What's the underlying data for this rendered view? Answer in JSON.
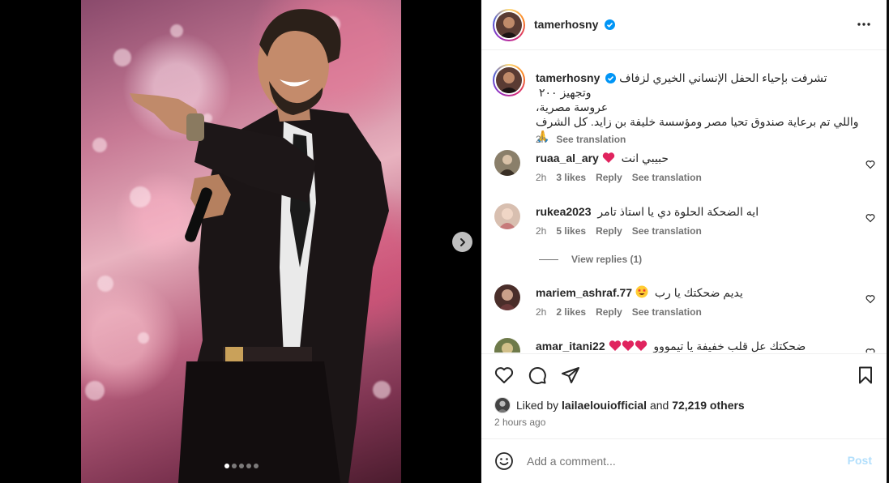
{
  "post": {
    "username": "tamerhosny",
    "caption_lines": [
      "تشرفت بإحياء الحفل الإنساني الخيري لزفاف وتجهيز ٢٠٠",
      "عروسة مصرية،",
      "واللي تم برعاية صندوق تحيا مصر ومؤسسة خليفة بن زايد. كل الشرف 🙏"
    ],
    "caption_time": "2h",
    "see_translation": "See translation"
  },
  "comments": [
    {
      "username": "ruaa_al_ary",
      "text": "حبيبي انت",
      "emoji": "red-heart",
      "time": "2h",
      "likes": "3 likes",
      "reply": "Reply",
      "translate": "See translation"
    },
    {
      "username": "rukea2023",
      "text": "ايه الضحكة الحلوة دي يا استاذ تامر",
      "emoji": "",
      "time": "2h",
      "likes": "5 likes",
      "reply": "Reply",
      "translate": "See translation"
    },
    {
      "username": "mariem_ashraf.77",
      "text": "يديم ضحكتك يا رب",
      "emoji": "star-struck",
      "time": "2h",
      "likes": "2 likes",
      "reply": "Reply",
      "translate": "See translation"
    },
    {
      "username": "amar_itani22",
      "text": "ضحكتك عل قلب خفيفة يا تيمووو",
      "emoji": "three-red-hearts",
      "time": "",
      "likes": "",
      "reply": "",
      "translate": ""
    }
  ],
  "view_replies": "View replies (1)",
  "liked_by": {
    "prefix": "Liked by",
    "user": "lailaelouiofficial",
    "middle": "and",
    "count": "72,219 others"
  },
  "posted_ago": "2 hours ago",
  "add_comment": {
    "placeholder": "Add a comment...",
    "post_label": "Post"
  },
  "carousel": {
    "slides": 5,
    "active": 1
  },
  "colors": {
    "verified": "#0095f6",
    "heart": "#ed4956",
    "post_disabled": "#b2dffc"
  }
}
